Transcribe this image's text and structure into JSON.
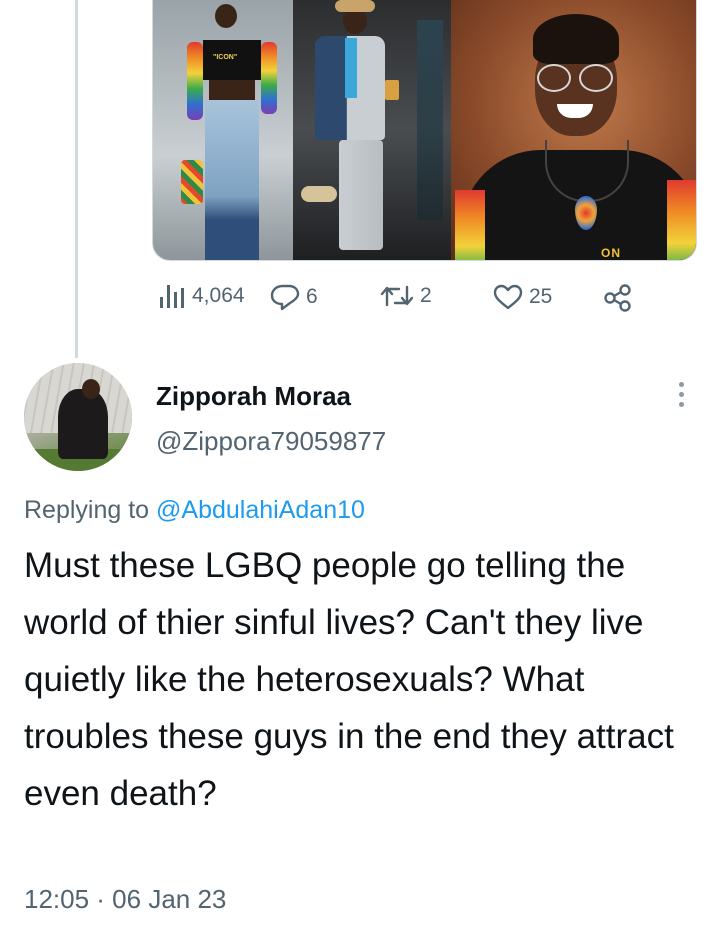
{
  "parent_tweet": {
    "media": [
      {
        "name": "photo-rainbow-outfit",
        "shirt_text": "\"ICON\""
      },
      {
        "name": "photo-blue-coat"
      },
      {
        "name": "photo-smiling-glasses",
        "shirt_text": "ON"
      }
    ],
    "actions": {
      "views_count": "4,064",
      "replies_count": "6",
      "retweets_count": "2",
      "likes_count": "25"
    }
  },
  "reply_tweet": {
    "display_name": "Zipporah Moraa",
    "handle": "@Zippora79059877",
    "replying_prefix": "Replying to",
    "replying_to": "@AbdulahiAdan10",
    "text": "Must these LGBQ people go telling the world of thier sinful lives? Can't they live quietly like the heterosexuals? What troubles these guys in the end they attract even death?",
    "timestamp": "12:05 · 06 Jan 23"
  },
  "colors": {
    "text_primary": "#0f1419",
    "text_secondary": "#536471",
    "link": "#1d9bf0",
    "thread_line": "#cfd9de"
  },
  "icons": [
    "views-icon",
    "reply-icon",
    "retweet-icon",
    "like-icon",
    "share-icon",
    "more-icon"
  ]
}
